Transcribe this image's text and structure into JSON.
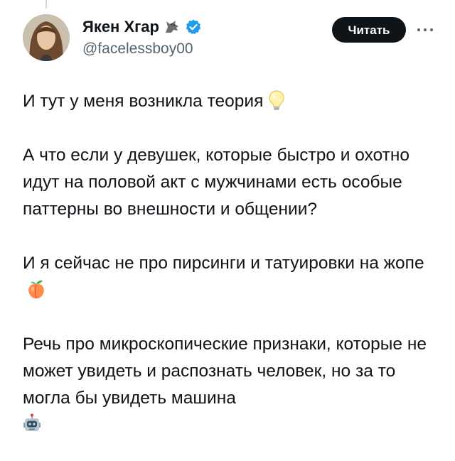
{
  "author": {
    "display_name": "Якен Хгар",
    "handle": "@facelessboy00",
    "badge_icon": "wolf-icon",
    "verified_icon": "verified-badge-icon",
    "verified_color": "#1d9bf0"
  },
  "actions": {
    "follow_label": "Читать",
    "more_icon": "more-dots-icon"
  },
  "tweet": {
    "paragraphs": [
      {
        "text": "И тут у меня возникла теория",
        "emoji": "lightbulb-icon"
      },
      {
        "text": "А что если у девушек, которые быстро и охотно идут на половой акт с мужчинами есть особые паттерны во внешности и общении?"
      },
      {
        "text": "И я сейчас не про пирсинги и татуировки на жопе",
        "emoji": "peach-icon"
      },
      {
        "text": "Речь про микроскопические признаки, которые не может увидеть и распознать человек, но за то могла бы увидеть машина",
        "emoji": "robot-icon"
      }
    ]
  }
}
